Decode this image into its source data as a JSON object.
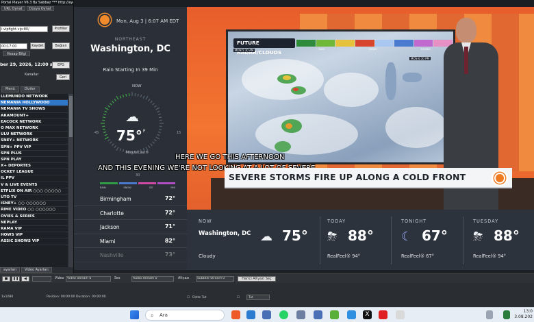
{
  "app": {
    "title": "Portal Player V6.3 By Sabbaz   ***   http://aydaportal.net ***",
    "top_tabs": [
      "URL Oynat",
      "Dosya Oynat"
    ],
    "url_value": "i.vipfight.vip:80/",
    "profiles_button": "Profiller",
    "time_value": "00:17:00",
    "save_button": "Kaydet",
    "connect_button": "Bağlan",
    "account_info_button": "Hesap Bilgi",
    "expiry_date": "ber 29, 2026, 12:00 a",
    "epg_button": "EPG",
    "channels_label": "Kanallar",
    "back_button": "Geri",
    "mid_tabs": [
      "Menü",
      "Diziler"
    ],
    "channels": [
      "LLEMUNDO NETWORK",
      "NEMANIA HOLLYWOOD",
      "NEMANIA TV SHOWS",
      "ARAMOUNT+",
      "EACOCK NETWORK",
      "O MAX NETWORK",
      "ULU NETWORK",
      "SNEY+ NETWORK",
      "SPN+ PPV VIP",
      "SPN PLUS",
      "SPN PLAY",
      "X+ DEPORTES",
      "OCKEY LEAGUE",
      "IL PPV",
      "V & LIVE EVENTS",
      "ETFLIX ON AIR  ○○○ ○○○○○",
      "UTO TV",
      "ISNEY+ ○○ ○○○○○○",
      "RIME VIDEO ○○ ○○○○○○",
      "OVIES & SERIES",
      "NEPLAY",
      "RAMA VIP",
      "HOWS VIP",
      "ASSIC SHOWS VIP"
    ],
    "selected_channel_index": 1,
    "bottom_tabs": [
      "ayarları",
      "Video Ayarları"
    ]
  },
  "controls": {
    "video_label": "Video",
    "video_stream": "Video Stream 0",
    "ses_label": "Ses",
    "audio_stream": "Audio Stream 0",
    "subtitle_label": "Altyazı",
    "subtitle_stream": "Subtitle Stream 0",
    "load_subtitle_button": "Harici Altyazı Seç",
    "position_text": "Position: 00:00:00  Duration: 00:00:00",
    "left_code": "1x1080",
    "ontop_label": "Üstte Tut",
    "tut_value": "Tut"
  },
  "weather_panel": {
    "date_time": "Mon, Aug 3  |  6:07 AM EDT",
    "region": "NORTHEAST",
    "city": "Washington, DC",
    "rain_text": "Rain Starting In 39 Min",
    "now_label": "NOW",
    "temperature": "75°",
    "unit": "F",
    "minutecast": "MinuteCast®",
    "dial_left": "45",
    "dial_right": "15",
    "dial_bottom": "30",
    "legend": [
      "RAIN",
      "SNOW",
      "ICE",
      "MIX"
    ],
    "legend_colors": [
      "#2f9e44",
      "#4a7bd1",
      "#d04aa5",
      "#b24dc8"
    ],
    "cities": [
      {
        "name": "Birmingham",
        "temp": "72°"
      },
      {
        "name": "Charlotte",
        "temp": "72°"
      },
      {
        "name": "Jackson",
        "temp": "71°"
      },
      {
        "name": "Miami",
        "temp": "82°"
      },
      {
        "name": "Nashville",
        "temp": "73°"
      }
    ]
  },
  "radar": {
    "title": "FUTURE RADAR/CLOUDS",
    "start_time": "MON 5:30 AM",
    "end_time": "MON 6:30 PM",
    "scale_labels": [
      "RAIN",
      "SNOW",
      "ICE/MIX"
    ]
  },
  "captions": [
    "HERE WE GO THIS AFTERNOON",
    "AND THIS EVENING WE'RE NOT LOOKING AT A LOT OF SEVERE"
  ],
  "lower_third": "SEVERE STORMS FIRE UP ALONG A COLD FRONT",
  "forecast": {
    "now_label": "NOW",
    "now_city": "Washington, DC",
    "now_temp": "75°",
    "now_condition": "Cloudy",
    "periods": [
      {
        "label": "TODAY",
        "temp": "88°",
        "realfeel": "RealFeel® 94°",
        "icon": "thunderstorm-icon"
      },
      {
        "label": "TONIGHT",
        "temp": "67°",
        "realfeel": "RealFeel® 67°",
        "icon": "night-storm-icon"
      },
      {
        "label": "TUESDAY",
        "temp": "88°",
        "realfeel": "RealFeel® 94°",
        "icon": "thunderstorm-icon"
      }
    ]
  },
  "taskbar": {
    "search_placeholder": "Ara",
    "time": "13:0",
    "date": "3.08.202"
  },
  "colors": {
    "accent_orange": "#ee7a22",
    "panel_dark": "#2b3038",
    "selected_blue": "#2f77c9"
  }
}
